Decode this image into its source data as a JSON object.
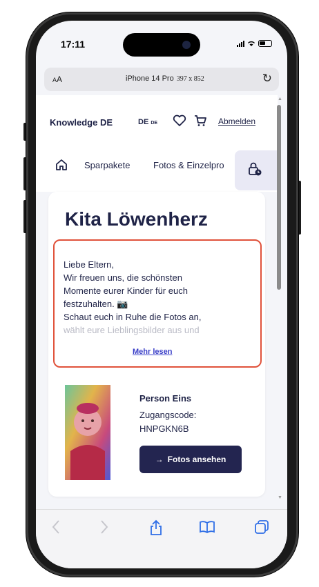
{
  "status_bar": {
    "time": "17:11"
  },
  "browser": {
    "text_size_label": "AA",
    "device_name": "iPhone 14 Pro",
    "device_size": "397 x 852",
    "reload_icon": "reload-icon"
  },
  "header": {
    "brand": "Knowledge DE",
    "language": "DE",
    "language_small": "DE",
    "logout": "Abmelden"
  },
  "nav": {
    "tabs": [
      {
        "label": "Sparpakete"
      },
      {
        "label": "Fotos & Einzelpro"
      }
    ]
  },
  "card": {
    "title": "Kita Löwenherz",
    "intro_lines": [
      "Liebe Eltern,",
      "Wir freuen uns, die schönsten",
      "Momente eurer Kinder für euch",
      "festzuhalten. 📷",
      "Schaut euch in Ruhe die Fotos an,"
    ],
    "intro_faded": "wählt eure Lieblingsbilder aus und",
    "more_link": "Mehr lesen",
    "person": {
      "name": "Person Eins",
      "access_label": "Zugangscode:",
      "access_code": "HNPGKN6B",
      "button": "Fotos ansehen"
    }
  },
  "colors": {
    "brand_dark": "#1f2347",
    "button_bg": "#232550",
    "highlight": "#e0513a",
    "link": "#3a3fc8"
  }
}
